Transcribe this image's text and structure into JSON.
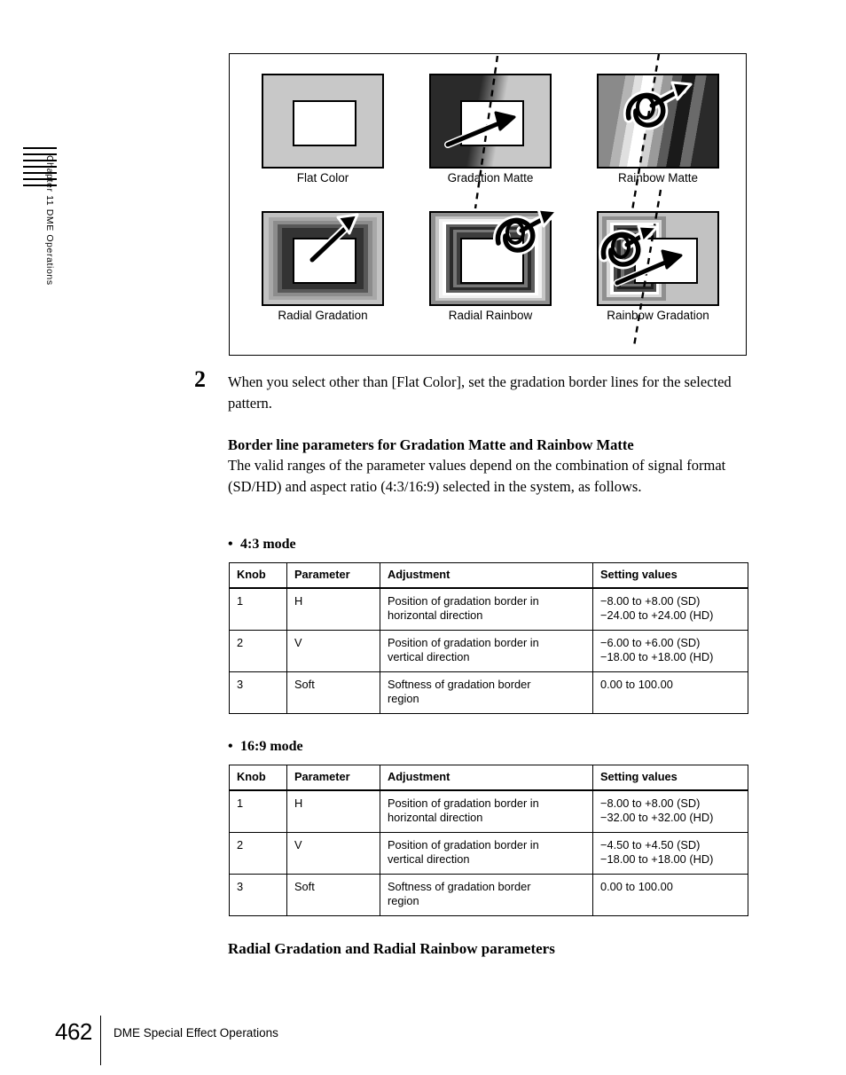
{
  "page": {
    "number": "462",
    "footer_title": "DME Special Effect Operations",
    "chapter_label": "Chapter 11  DME Operations"
  },
  "figure": {
    "items": [
      {
        "label": "Flat Color",
        "kind": "flat"
      },
      {
        "label": "Gradation Matte",
        "kind": "gradation-matte"
      },
      {
        "label": "Rainbow Matte",
        "kind": "rainbow-matte"
      },
      {
        "label": "Radial Gradation",
        "kind": "radial-gradation"
      },
      {
        "label": "Radial Rainbow",
        "kind": "radial-rainbow"
      },
      {
        "label": "Rainbow Gradation",
        "kind": "rainbow-gradation"
      }
    ]
  },
  "step": {
    "number": "2",
    "text": "When you select other than [Flat Color], set the gradation border lines for the selected pattern."
  },
  "border_params": {
    "heading": "Border line parameters for Gradation Matte and Rainbow Matte",
    "body": "The valid ranges of the parameter values depend on the combination of signal format (SD/HD) and aspect ratio (4:3/16:9) selected in the system, as follows."
  },
  "modes": {
    "mode_43_label": "4:3 mode",
    "mode_169_label": "16:9 mode"
  },
  "table_columns": {
    "knob": "Knob",
    "parameter": "Parameter",
    "adjustment": "Adjustment",
    "setting_values": "Setting values"
  },
  "table_43": {
    "rows": [
      {
        "knob": "1",
        "parameter": "H",
        "adjustment_l1": "Position of gradation border in",
        "adjustment_l2": "horizontal direction",
        "setting_l1": "−8.00 to +8.00 (SD)",
        "setting_l2": "−24.00 to +24.00 (HD)"
      },
      {
        "knob": "2",
        "parameter": "V",
        "adjustment_l1": "Position of gradation border in",
        "adjustment_l2": "vertical direction",
        "setting_l1": "−6.00 to +6.00 (SD)",
        "setting_l2": "−18.00 to +18.00 (HD)"
      },
      {
        "knob": "3",
        "parameter": "Soft",
        "adjustment_l1": "Softness of gradation border",
        "adjustment_l2": "region",
        "setting_l1": "0.00 to 100.00",
        "setting_l2": ""
      }
    ]
  },
  "table_169": {
    "rows": [
      {
        "knob": "1",
        "parameter": "H",
        "adjustment_l1": "Position of gradation border in",
        "adjustment_l2": "horizontal direction",
        "setting_l1": "−8.00 to +8.00 (SD)",
        "setting_l2": "−32.00 to +32.00 (HD)"
      },
      {
        "knob": "2",
        "parameter": "V",
        "adjustment_l1": "Position of gradation border in",
        "adjustment_l2": "vertical direction",
        "setting_l1": "−4.50 to +4.50 (SD)",
        "setting_l2": "−18.00 to +18.00 (HD)"
      },
      {
        "knob": "3",
        "parameter": "Soft",
        "adjustment_l1": "Softness of gradation border",
        "adjustment_l2": "region",
        "setting_l1": "0.00 to 100.00",
        "setting_l2": ""
      }
    ]
  },
  "radial_section": {
    "heading": "Radial Gradation and Radial Rainbow parameters"
  },
  "colors": {
    "ink": "#000000",
    "paper": "#ffffff",
    "light_gray": "#c8c8c8",
    "mid_gray": "#8a8a8a",
    "dark_gray": "#3a3a3a",
    "near_black": "#1e1e1e"
  }
}
